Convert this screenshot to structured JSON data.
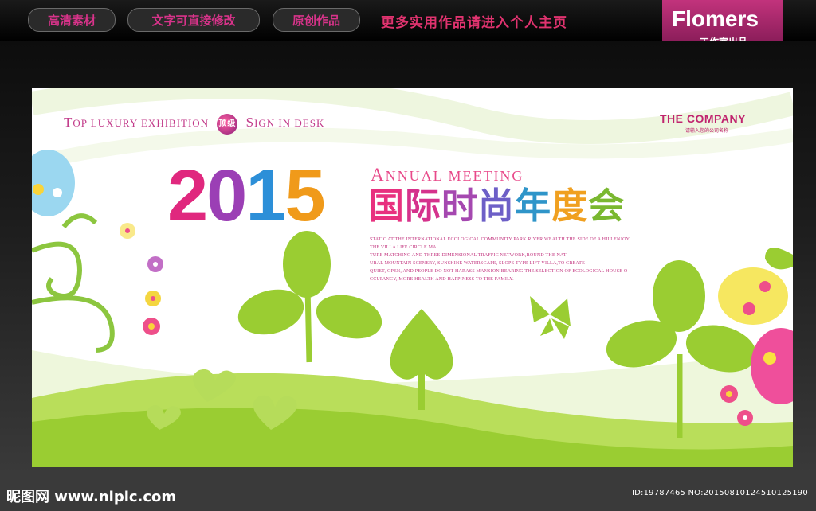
{
  "topbar": {
    "pills": [
      "高清素材",
      "文字可直接修改",
      "原创作品"
    ],
    "promo": "更多实用作品请进入个人主页",
    "logo_title": "Flomers",
    "logo_sub": "工作室出品"
  },
  "banner": {
    "top_left": {
      "part1_cap": "T",
      "part1": "OP LUXURY EXHIBITION",
      "badge": "顶级",
      "part2_cap": "S",
      "part2": "IGN IN DESK"
    },
    "company": "THE COMPANY",
    "company_sub": "请输入您的公司名称",
    "year_digits": [
      "2",
      "0",
      "1",
      "5"
    ],
    "annual_cap": "A",
    "annual_rest": "NNUAL MEETING",
    "cn_title_chars": [
      "国",
      "际",
      "时",
      "尚",
      "年",
      "度",
      "会"
    ],
    "body_lines": [
      "STATIC AT THE INTERNATIONAL ECOLOGICAL COMMUNITY PARK RIVER WEALTH THE SIDE OF A HILLENJOY",
      "THE VILLA LIFE CIRCLE MA",
      "TURE MATCHING AND THREE-DIMENSIONAL TRAFFIC NETWORK,ROUND THE NAT",
      "URAL MOUNTAIN SCENERY, SUNSHINE WATERSCAPE, SLOPE TYPE LIFT VILLA,TO CREATE",
      "QUIET, OPEN, AND PEOPLE DO NOT HARASS MANSION BEARING,THE SELECTION OF ECOLOGICAL HOUSE O",
      "CCUPANCY, MORE HEALTH AND HAPPINESS TO THE FAMILY."
    ]
  },
  "colors": {
    "year": [
      "#e0287e",
      "#9b3fb5",
      "#2c8fd8",
      "#f09a1a"
    ],
    "cn_title": [
      "#e8317f",
      "#d5328c",
      "#a548b0",
      "#6d5fc7",
      "#2f95c9",
      "#f0a020",
      "#7ab830"
    ],
    "green": "#9acd32",
    "accent": "#d8338a"
  },
  "watermark": {
    "left": "昵图网 www.nipic.com",
    "right": "ID:19787465 NO:20150810124510125190"
  }
}
